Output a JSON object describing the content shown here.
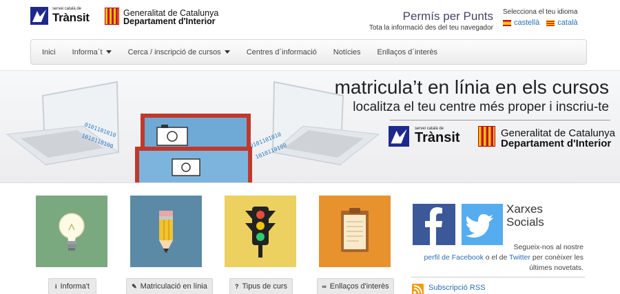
{
  "header": {
    "transit_small": "servei català de",
    "transit_name": "Trànsit",
    "gen_line1": "Generalitat de Catalunya",
    "gen_line2": "Departament d'Interior",
    "site_title": "Permís per Punts",
    "site_subtitle": "Tota la informació des del teu navegador",
    "language_label": "Selecciona el teu idioma",
    "languages": [
      {
        "label": "castellà",
        "flag": "flag-es-icon"
      },
      {
        "label": "català",
        "flag": "flag-ca-icon"
      }
    ]
  },
  "nav": {
    "items": [
      {
        "label": "Inici"
      },
      {
        "label": "Informa´t"
      },
      {
        "label": "Cerca / inscripció de cursos"
      },
      {
        "label": "Centres d´informació"
      },
      {
        "label": "Notícies"
      },
      {
        "label": "Enllaços d´interès"
      }
    ]
  },
  "banner": {
    "title": "matricula’t en línia en els cursos",
    "subtitle": "localitza el teu centre més proper i inscriu-te",
    "transit_small": "servei català de",
    "transit_name": "Trànsit",
    "gen_line1": "Generalitat de Catalunya",
    "gen_line2": "Departament d'Interior"
  },
  "tiles": [
    {
      "label": "Informa't",
      "icon": "info-icon",
      "picture": "lightbulb-icon",
      "bg": "#7aa87f"
    },
    {
      "label": "Matriculació en línia",
      "icon": "pencil-icon",
      "picture": "pencil-icon",
      "bg": "#5b8aa6"
    },
    {
      "label": "Tipus de curs",
      "icon": "question-icon",
      "picture": "traffic-light-icon",
      "bg": "#ecd060"
    },
    {
      "label": "Enllaços d'interès",
      "icon": "link-icon",
      "picture": "clipboard-icon",
      "bg": "#e8922e"
    }
  ],
  "social": {
    "title_line1": "Xarxes",
    "title_line2": "Socials",
    "text_prefix": "Segueix-nos al nostre",
    "facebook_link": "perfil de Facebook",
    "text_mid": "o el de",
    "twitter_link": "Twitter",
    "text_suffix": "per conèixer les últimes novetats.",
    "rss_label": "Subscripció RSS"
  },
  "colors": {
    "link": "#2a6fb4",
    "facebook": "#3b5998",
    "twitter": "#55acee",
    "transit_blue": "#1d2a8c"
  }
}
